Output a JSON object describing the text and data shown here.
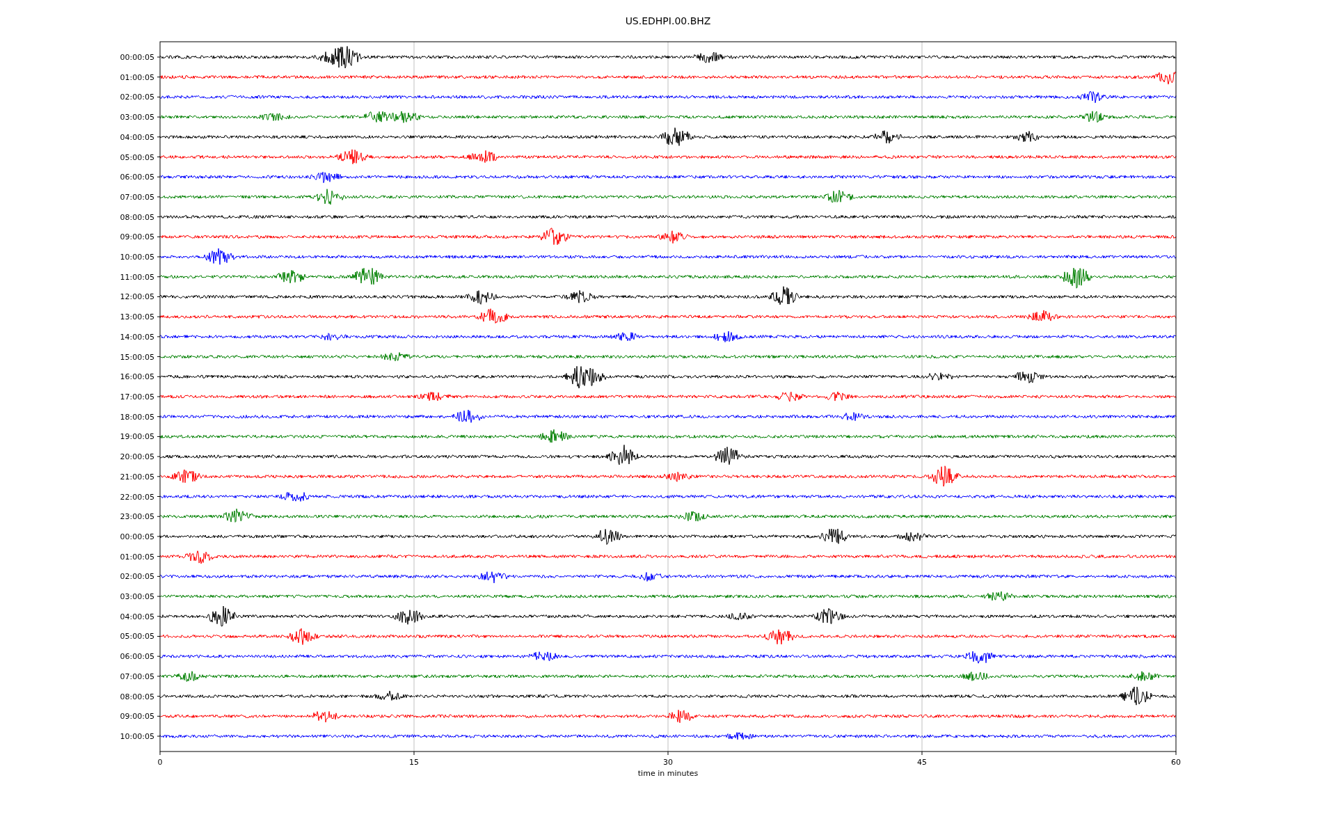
{
  "title": "US.EDHPI.00.BHZ",
  "rows": [
    {
      "label": "00:00:05",
      "color": "#000000"
    },
    {
      "label": "01:00:05",
      "color": "#ff0000"
    },
    {
      "label": "02:00:05",
      "color": "#0000ff"
    },
    {
      "label": "03:00:05",
      "color": "#008000"
    },
    {
      "label": "04:00:05",
      "color": "#000000"
    },
    {
      "label": "05:00:05",
      "color": "#ff0000"
    },
    {
      "label": "06:00:05",
      "color": "#0000ff"
    },
    {
      "label": "07:00:05",
      "color": "#008000"
    },
    {
      "label": "08:00:05",
      "color": "#000000"
    },
    {
      "label": "09:00:05",
      "color": "#ff0000"
    },
    {
      "label": "10:00:05",
      "color": "#0000ff"
    },
    {
      "label": "11:00:05",
      "color": "#008000"
    },
    {
      "label": "12:00:05",
      "color": "#000000"
    },
    {
      "label": "13:00:05",
      "color": "#ff0000"
    },
    {
      "label": "14:00:05",
      "color": "#0000ff"
    },
    {
      "label": "15:00:05",
      "color": "#008000"
    },
    {
      "label": "16:00:05",
      "color": "#000000"
    },
    {
      "label": "17:00:05",
      "color": "#ff0000"
    },
    {
      "label": "18:00:05",
      "color": "#0000ff"
    },
    {
      "label": "19:00:05",
      "color": "#008000"
    },
    {
      "label": "20:00:05",
      "color": "#000000"
    },
    {
      "label": "21:00:05",
      "color": "#ff0000"
    },
    {
      "label": "22:00:05",
      "color": "#0000ff"
    },
    {
      "label": "23:00:05",
      "color": "#008000"
    },
    {
      "label": "00:00:05",
      "color": "#000000"
    },
    {
      "label": "01:00:05",
      "color": "#ff0000"
    },
    {
      "label": "02:00:05",
      "color": "#0000ff"
    },
    {
      "label": "03:00:05",
      "color": "#008000"
    },
    {
      "label": "04:00:05",
      "color": "#000000"
    },
    {
      "label": "05:00:05",
      "color": "#ff0000"
    },
    {
      "label": "06:00:05",
      "color": "#0000ff"
    },
    {
      "label": "07:00:05",
      "color": "#008000"
    },
    {
      "label": "08:00:05",
      "color": "#000000"
    },
    {
      "label": "09:00:05",
      "color": "#ff0000"
    },
    {
      "label": "10:00:05",
      "color": "#0000ff"
    }
  ],
  "x_axis": {
    "ticks": [
      "0",
      "15",
      "30",
      "45",
      "60"
    ],
    "label": "time in minutes"
  }
}
